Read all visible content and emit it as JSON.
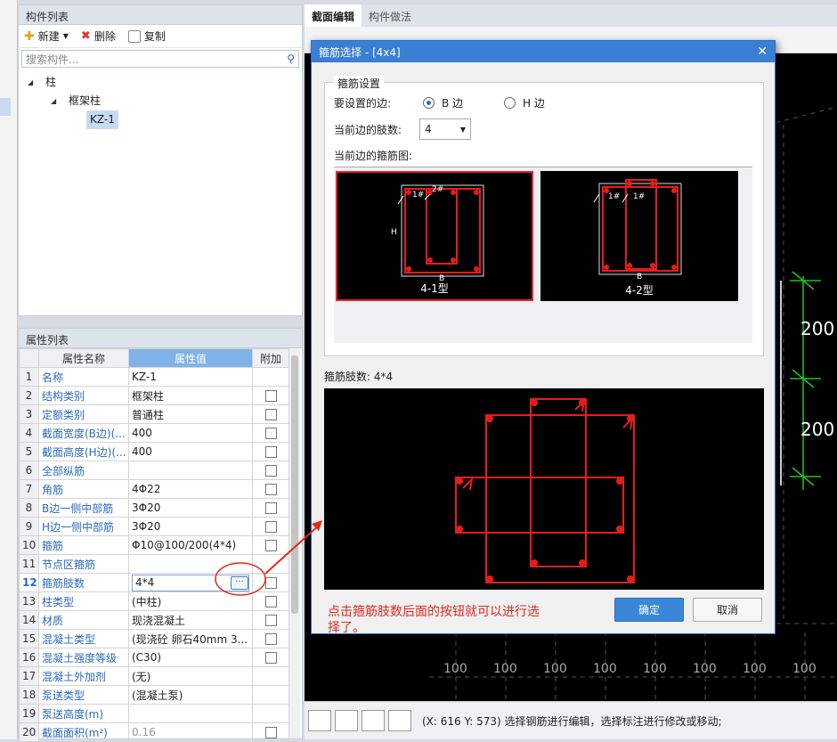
{
  "component_panel": {
    "title": "构件列表",
    "toolbar": {
      "new_label": "新建",
      "delete_label": "删除",
      "copy_label": "复制"
    },
    "search_placeholder": "搜索构件...",
    "tree": {
      "root": "柱",
      "child": "框架柱",
      "leaf": "KZ-1"
    }
  },
  "attribute_panel": {
    "title": "属性列表",
    "columns": [
      "属性名称",
      "属性值",
      "附加"
    ],
    "rows": [
      {
        "idx": "1",
        "name": "名称",
        "value": "KZ-1"
      },
      {
        "idx": "2",
        "name": "结构类别",
        "value": "框架柱"
      },
      {
        "idx": "3",
        "name": "定额类别",
        "value": "普通柱"
      },
      {
        "idx": "4",
        "name": "截面宽度(B边)(...",
        "value": "400"
      },
      {
        "idx": "5",
        "name": "截面高度(H边)(...",
        "value": "400"
      },
      {
        "idx": "6",
        "name": "全部纵筋",
        "value": ""
      },
      {
        "idx": "7",
        "name": "角筋",
        "value": "4Φ22"
      },
      {
        "idx": "8",
        "name": "B边一侧中部筋",
        "value": "3Φ20"
      },
      {
        "idx": "9",
        "name": "H边一侧中部筋",
        "value": "3Φ20"
      },
      {
        "idx": "10",
        "name": "箍筋",
        "value": "Φ10@100/200(4*4)"
      },
      {
        "idx": "11",
        "name": "节点区箍筋",
        "value": ""
      },
      {
        "idx": "12",
        "name": "箍筋肢数",
        "value": "4*4"
      },
      {
        "idx": "13",
        "name": "柱类型",
        "value": "(中柱)"
      },
      {
        "idx": "14",
        "name": "材质",
        "value": "现浇混凝土"
      },
      {
        "idx": "15",
        "name": "混凝土类型",
        "value": "(现浇砼 卵石40mm 3..."
      },
      {
        "idx": "16",
        "name": "混凝土强度等级",
        "value": "(C30)"
      },
      {
        "idx": "17",
        "name": "混凝土外加剂",
        "value": "(无)"
      },
      {
        "idx": "18",
        "name": "泵送类型",
        "value": "(混凝土泵)"
      },
      {
        "idx": "19",
        "name": "泵送高度(m)",
        "value": ""
      },
      {
        "idx": "20",
        "name": "截面面积(m²)",
        "value": "0.16"
      }
    ],
    "ellipsis": "···"
  },
  "right_panel": {
    "tabs": [
      "截面编辑",
      "构件做法"
    ],
    "status_text": "(X: 616 Y: 573)  选择钢筋进行编辑，选择标注进行修改或移动;",
    "dims": [
      "200",
      "200"
    ],
    "grid_ticks": [
      "100",
      "100",
      "100",
      "100",
      "100",
      "100",
      "100",
      "100",
      "100",
      "100"
    ]
  },
  "dialog": {
    "title": "箍筋选择 - [4x4]",
    "group_title": "箍筋设置",
    "edge_label": "要设置的边:",
    "b_label": "B 边",
    "h_label": "H 边",
    "count_label": "当前边的肢数:",
    "count_value": "4",
    "diagram_label": "当前边的箍筋图:",
    "types": [
      "4-1型",
      "4-2型"
    ],
    "rebar_tags": [
      "1#",
      "2#"
    ],
    "letters": {
      "b": "B",
      "h": "H"
    },
    "result_label": "箍筋肢数: 4*4",
    "ok": "确定",
    "cancel": "取消"
  },
  "annotation": "点击箍筋肢数后面的按钮就可以进行选择了。",
  "colors": {
    "accent": "#3a7fd5",
    "rebar": "#e81c1c",
    "note": "#e5281b"
  }
}
